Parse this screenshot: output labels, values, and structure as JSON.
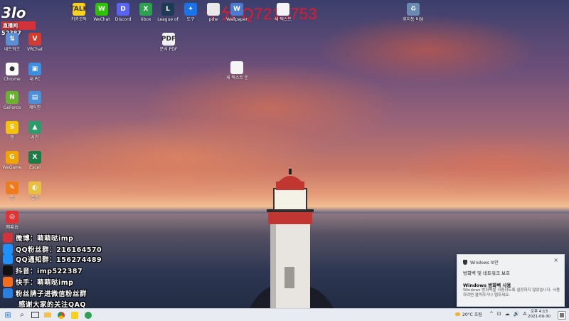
{
  "watermark": "千分 Q7215753",
  "overlay": {
    "logo_text": "3lo",
    "logo_sub": "直播间",
    "logo_number": "52387",
    "lines": [
      {
        "icon": "weibo-icon",
        "text": "微博：萌萌哒imp",
        "color": "#d2323a"
      },
      {
        "icon": "qq-icon",
        "text": "QQ粉丝群：216164570",
        "color": "#1e90ff"
      },
      {
        "icon": "qq-icon",
        "text": "QQ通知群：156274489",
        "color": "#1e90ff"
      },
      {
        "icon": "douyin-icon",
        "text": "抖音：imp522387",
        "color": "#111111"
      },
      {
        "icon": "kuaishou-icon",
        "text": "快手：萌萌哒imp",
        "color": "#f76b1c"
      },
      {
        "icon": "live-icon",
        "text": "粉丝牌子进微信粉丝群",
        "color": "#2a7de1"
      },
      {
        "icon": "",
        "text": "感谢大家的关注QAQ",
        "color": ""
      }
    ]
  },
  "desktop_icons": [
    {
      "name": "kakaotalk",
      "label": "카카오톡",
      "color": "#f7d21c",
      "glyph": "TALK"
    },
    {
      "name": "wechat",
      "label": "WeChat",
      "color": "#2dc100",
      "glyph": "W"
    },
    {
      "name": "discord",
      "label": "Discord",
      "color": "#5865f2",
      "glyph": "D"
    },
    {
      "name": "xbox",
      "label": "Xbox",
      "color": "#2ca24f",
      "glyph": "X"
    },
    {
      "name": "league",
      "label": "League of",
      "color": "#1e3b55",
      "glyph": "L"
    },
    {
      "name": "tool",
      "label": "도구",
      "color": "#1a73e8",
      "glyph": "✦"
    },
    {
      "name": "file-a",
      "label": "pdw",
      "color": "#e8e8e8",
      "glyph": ""
    },
    {
      "name": "file-b",
      "label": "Wallpaper",
      "color": "#4a7bd0",
      "glyph": "W"
    },
    {
      "name": "doc-a",
      "label": "새 텍스트",
      "color": "#f5f5f5",
      "glyph": ""
    },
    {
      "name": "recycle-bin",
      "label": "휴지통 비움",
      "color": "#6a8ab4",
      "glyph": "♻"
    },
    {
      "name": "pdf",
      "label": "문서 PDF",
      "color": "#f2f2f2",
      "glyph": "PDF"
    },
    {
      "name": "doc-b",
      "label": "새 텍스트 문서",
      "color": "#f5f5f5",
      "glyph": ""
    },
    {
      "name": "network",
      "label": "네트워크",
      "color": "#5a8fd6",
      "glyph": "⇅"
    },
    {
      "name": "vrchat",
      "label": "VRChat",
      "color": "#d23b2f",
      "glyph": "V"
    },
    {
      "name": "chrome",
      "label": "Chrome",
      "color": "#ffffff",
      "glyph": "●"
    },
    {
      "name": "this-pc",
      "label": "내 PC",
      "color": "#3d8fe0",
      "glyph": "▣"
    },
    {
      "name": "nvidia",
      "label": "GeForce",
      "color": "#6bb32e",
      "glyph": "N"
    },
    {
      "name": "control",
      "label": "제어판",
      "color": "#4a90d9",
      "glyph": "▤"
    },
    {
      "name": "app-y",
      "label": "앱",
      "color": "#f4c20d",
      "glyph": "S"
    },
    {
      "name": "app-z",
      "label": "사진",
      "color": "#2c9c6a",
      "glyph": "▲"
    },
    {
      "name": "game-a",
      "label": "WeGame",
      "color": "#f0a500",
      "glyph": "G"
    },
    {
      "name": "excel",
      "label": "Excel",
      "color": "#1d7a45",
      "glyph": "X"
    },
    {
      "name": "app-c",
      "label": "앱",
      "color": "#ef7c1a",
      "glyph": "✎"
    },
    {
      "name": "app-d",
      "label": "설정",
      "color": "#e7c042",
      "glyph": "◐"
    },
    {
      "name": "netease",
      "label": "网易云",
      "color": "#e03434",
      "glyph": "◎"
    }
  ],
  "toast": {
    "app_name": "Windows 보안",
    "title": "방화벽 및 네트워크 보호",
    "subtitle": "Windows 방화벽 사용",
    "body": "Windows 방화벽을 사용하도록 설정하지 않았습니다. 사용하려면 클릭하거나 탭하세요.",
    "close_glyph": "×"
  },
  "taskbar": {
    "start_glyph": "⊞",
    "search_glyph": "⌕",
    "apps": [
      "task-view",
      "file-explorer",
      "chrome",
      "kakaotalk-taskbar",
      "xbox-taskbar"
    ],
    "weather": "20°C 흐림",
    "tray_icons": [
      "^",
      "⊡",
      "☁",
      "🔊",
      "A"
    ],
    "time": "오후 4:13",
    "date": "2021-09-30"
  }
}
